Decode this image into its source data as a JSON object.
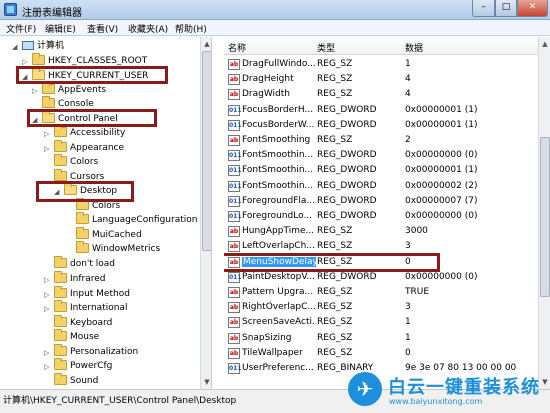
{
  "window": {
    "title": "注册表编辑器",
    "min_label": "–",
    "max_label": "□",
    "close_label": "✕"
  },
  "menu": [
    "文件(F)",
    "编辑(E)",
    "查看(V)",
    "收藏夹(A)",
    "帮助(H)"
  ],
  "tree": {
    "nodes": [
      {
        "label": "计算机",
        "expander": "◢",
        "icon": "computer-icon"
      },
      {
        "label": "HKEY_CLASSES_ROOT",
        "expander": "▷",
        "icon": "folder-icon"
      },
      {
        "label": "HKEY_CURRENT_USER",
        "expander": "◢",
        "icon": "folder-icon"
      },
      {
        "label": "AppEvents",
        "expander": "▷",
        "icon": "folder-icon"
      },
      {
        "label": "Console",
        "expander": "",
        "icon": "folder-icon"
      },
      {
        "label": "Control Panel",
        "expander": "◢",
        "icon": "folder-icon"
      },
      {
        "label": "Accessibility",
        "expander": "▷",
        "icon": "folder-icon"
      },
      {
        "label": "Appearance",
        "expander": "▷",
        "icon": "folder-icon"
      },
      {
        "label": "Colors",
        "expander": "",
        "icon": "folder-icon"
      },
      {
        "label": "Cursors",
        "expander": "",
        "icon": "folder-icon"
      },
      {
        "label": "Desktop",
        "expander": "◢",
        "icon": "folder-open-icon"
      },
      {
        "label": "Colors",
        "expander": "",
        "icon": "folder-icon"
      },
      {
        "label": "LanguageConfiguration",
        "expander": "",
        "icon": "folder-icon"
      },
      {
        "label": "MuiCached",
        "expander": "",
        "icon": "folder-icon"
      },
      {
        "label": "WindowMetrics",
        "expander": "",
        "icon": "folder-icon"
      },
      {
        "label": "don't load",
        "expander": "",
        "icon": "folder-icon"
      },
      {
        "label": "Infrared",
        "expander": "▷",
        "icon": "folder-icon"
      },
      {
        "label": "Input Method",
        "expander": "▷",
        "icon": "folder-icon"
      },
      {
        "label": "International",
        "expander": "▷",
        "icon": "folder-icon"
      },
      {
        "label": "Keyboard",
        "expander": "",
        "icon": "folder-icon"
      },
      {
        "label": "Mouse",
        "expander": "",
        "icon": "folder-icon"
      },
      {
        "label": "Personalization",
        "expander": "▷",
        "icon": "folder-icon"
      },
      {
        "label": "PowerCfg",
        "expander": "▷",
        "icon": "folder-icon"
      },
      {
        "label": "Sound",
        "expander": "",
        "icon": "folder-icon"
      }
    ]
  },
  "list": {
    "columns": [
      "名称",
      "类型",
      "数据"
    ],
    "rows": [
      {
        "name": "DragFullWindo...",
        "type": "REG_SZ",
        "data": "1",
        "kind": "ab"
      },
      {
        "name": "DragHeight",
        "type": "REG_SZ",
        "data": "4",
        "kind": "ab"
      },
      {
        "name": "DragWidth",
        "type": "REG_SZ",
        "data": "4",
        "kind": "ab"
      },
      {
        "name": "FocusBorderH...",
        "type": "REG_DWORD",
        "data": "0x00000001 (1)",
        "kind": "dw"
      },
      {
        "name": "FocusBorderW...",
        "type": "REG_DWORD",
        "data": "0x00000001 (1)",
        "kind": "dw"
      },
      {
        "name": "FontSmoothing",
        "type": "REG_SZ",
        "data": "2",
        "kind": "ab"
      },
      {
        "name": "FontSmoothin...",
        "type": "REG_DWORD",
        "data": "0x00000000 (0)",
        "kind": "dw"
      },
      {
        "name": "FontSmoothin...",
        "type": "REG_DWORD",
        "data": "0x00000001 (1)",
        "kind": "dw"
      },
      {
        "name": "FontSmoothin...",
        "type": "REG_DWORD",
        "data": "0x00000002 (2)",
        "kind": "dw"
      },
      {
        "name": "ForegroundFla...",
        "type": "REG_DWORD",
        "data": "0x00000007 (7)",
        "kind": "dw"
      },
      {
        "name": "ForegroundLo...",
        "type": "REG_DWORD",
        "data": "0x00000000 (0)",
        "kind": "dw"
      },
      {
        "name": "HungAppTime...",
        "type": "REG_SZ",
        "data": "3000",
        "kind": "ab"
      },
      {
        "name": "LeftOverlapCh...",
        "type": "REG_SZ",
        "data": "3",
        "kind": "ab"
      },
      {
        "name": "MenuShowDelay",
        "type": "REG_SZ",
        "data": "0",
        "kind": "ab"
      },
      {
        "name": "PaintDesktopV...",
        "type": "REG_DWORD",
        "data": "0x00000000 (0)",
        "kind": "dw"
      },
      {
        "name": "Pattern Upgra...",
        "type": "REG_SZ",
        "data": "TRUE",
        "kind": "ab"
      },
      {
        "name": "RightOverlapC...",
        "type": "REG_SZ",
        "data": "3",
        "kind": "ab"
      },
      {
        "name": "ScreenSaveActi...",
        "type": "REG_SZ",
        "data": "1",
        "kind": "ab"
      },
      {
        "name": "SnapSizing",
        "type": "REG_SZ",
        "data": "1",
        "kind": "ab"
      },
      {
        "name": "TileWallpaper",
        "type": "REG_SZ",
        "data": "0",
        "kind": "ab"
      },
      {
        "name": "UserPreferenc...",
        "type": "REG_BINARY",
        "data": "9e 3e 07 80 13 00 00 00",
        "kind": "bin"
      }
    ],
    "selected_row": "MenuShowDelay"
  },
  "status": {
    "path": "计算机\\HKEY_CURRENT_USER\\Control Panel\\Desktop"
  },
  "watermark": {
    "brand": "白云一键重装系统",
    "url": "www.baiyunxitong.com"
  },
  "colors": {
    "highlight_box": "#8b1a1a",
    "selection": "#3399ff",
    "watermark": "#1e8fdc"
  }
}
